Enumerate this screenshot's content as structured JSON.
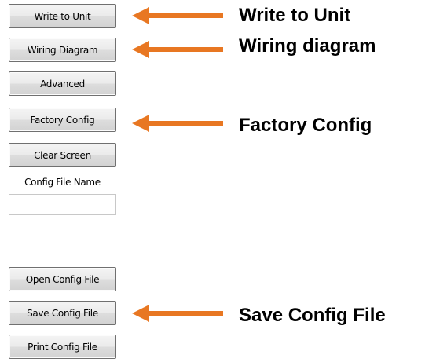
{
  "buttons": {
    "write_to_unit": "Write to Unit",
    "wiring_diagram": "Wiring Diagram",
    "advanced": "Advanced",
    "factory_config": "Factory Config",
    "clear_screen": "Clear Screen",
    "open_config_file": "Open Config File",
    "save_config_file": "Save Config File",
    "print_config_file": "Print Config File"
  },
  "config_file": {
    "label": "Config File Name",
    "value": ""
  },
  "callouts": {
    "write_to_unit": "Write to Unit",
    "wiring_diagram": "Wiring diagram",
    "factory_config": "Factory Config",
    "save_config_file": "Save Config File"
  },
  "colors": {
    "arrow": "#e87722"
  }
}
